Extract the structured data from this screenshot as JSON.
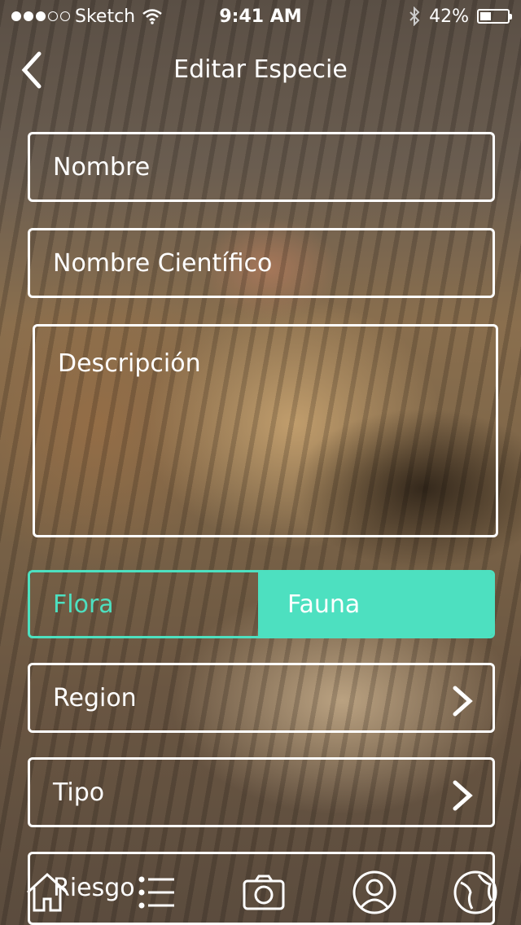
{
  "status_bar": {
    "carrier": "Sketch",
    "time": "9:41 AM",
    "battery": "42%",
    "battery_level": 0.42
  },
  "nav": {
    "title": "Editar Especie",
    "back_icon": "chevron-left-icon"
  },
  "form": {
    "nombre_placeholder": "Nombre",
    "nombre_cientifico_placeholder": "Nombre Científico",
    "descripcion_placeholder": "Descripción",
    "segment": {
      "options": [
        "Flora",
        "Fauna"
      ],
      "selected": "Fauna"
    },
    "region_label": "Region",
    "tipo_label": "Tipo",
    "riesgo_label": "Riesgo"
  },
  "tabbar": {
    "items": [
      "home-icon",
      "list-icon",
      "camera-icon",
      "profile-icon",
      "globe-icon"
    ]
  },
  "colors": {
    "accent": "#4de0c0",
    "text": "#ffffff"
  }
}
